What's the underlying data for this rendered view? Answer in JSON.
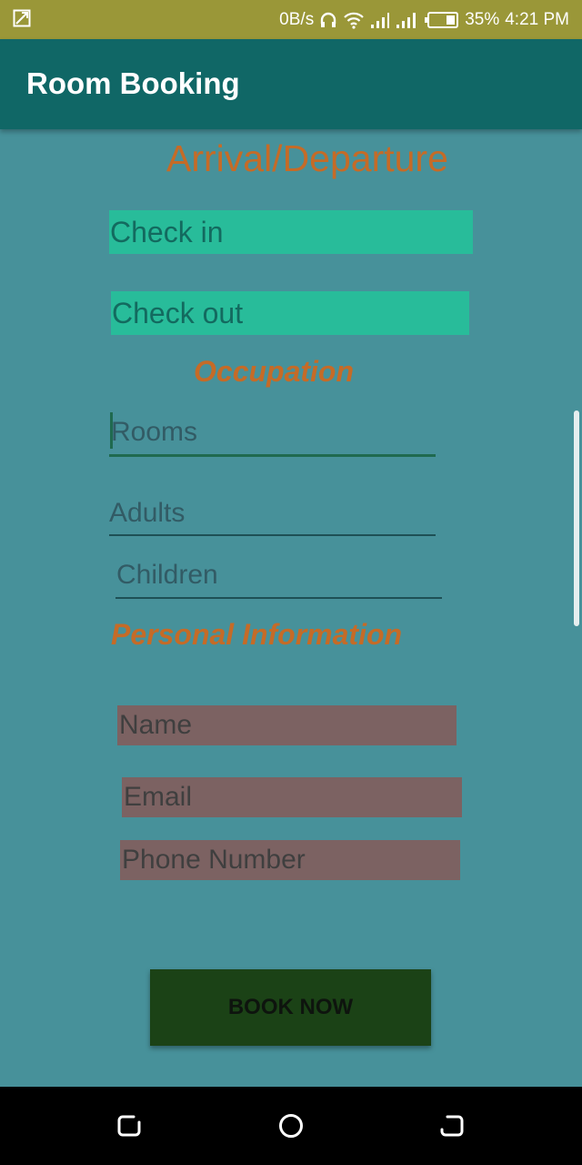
{
  "status_bar": {
    "left_icon": "screen-cast-icon",
    "speed": "0B/s",
    "icons": [
      "headphones-icon",
      "wifi-icon",
      "signal-icon",
      "signal-icon",
      "battery-icon"
    ],
    "battery": "35%",
    "time": "4:21 PM"
  },
  "app_bar": {
    "title": "Room Booking"
  },
  "form": {
    "arrival_title": "Arrival/Departure",
    "check_in": "Check in",
    "check_out": "Check out",
    "occupation_title": "Occupation",
    "rooms_placeholder": "Rooms",
    "adults_placeholder": "Adults",
    "children_placeholder": "Children",
    "personal_title": "Personal Information",
    "name_placeholder": "Name",
    "email_placeholder": "Email",
    "phone_placeholder": "Phone Number",
    "book_button": "BOOK NOW"
  },
  "nav_bar": {
    "buttons": [
      "back-icon",
      "home-icon",
      "recent-apps-icon"
    ]
  },
  "colors": {
    "background": "#47919a",
    "status_bar": "#9a9738",
    "app_bar": "#106766",
    "heading": "#c56b27",
    "date_button": "#28bc9a",
    "personal_field": "#7c6262",
    "book_button": "#1b4216"
  }
}
